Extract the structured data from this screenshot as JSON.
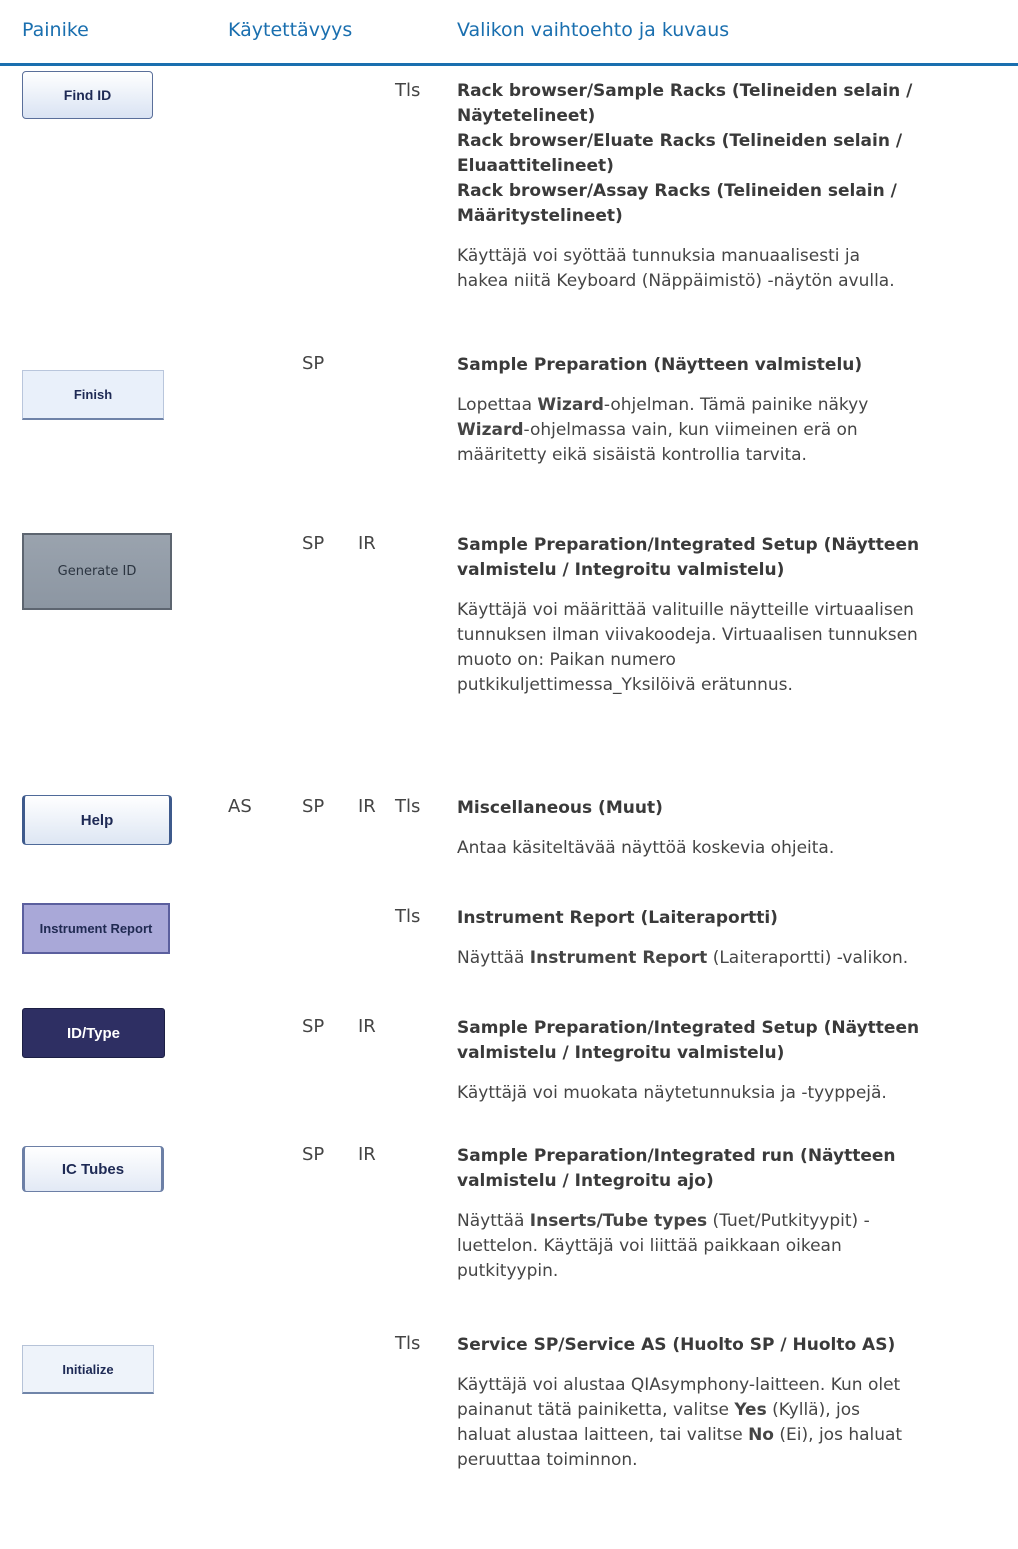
{
  "header": {
    "col_button": "Painike",
    "col_usage": "Käytettävyys",
    "col_menu": "Valikon vaihtoehto ja kuvaus"
  },
  "rows": [
    {
      "button": "Find ID",
      "usage": {
        "as": "",
        "sp": "",
        "ir": "",
        "tls": "Tls"
      },
      "title_lines": [
        "Rack browser/Sample Racks (Telineiden selain /",
        "Näytetelineet)",
        "Rack browser/Eluate Racks (Telineiden selain /",
        "Eluaattitelineet)",
        "Rack browser/Assay Racks (Telineiden selain /",
        "Määritystelineet)"
      ],
      "desc_lines": [
        "Käyttäjä voi syöttää tunnuksia manuaalisesti ja",
        "hakea niitä Keyboard (Näppäimistö) -näytön avulla."
      ]
    },
    {
      "button": "Finish",
      "usage": {
        "as": "",
        "sp": "SP",
        "ir": "",
        "tls": ""
      },
      "title_lines": [
        "Sample Preparation (Näytteen valmistelu)"
      ],
      "desc_lines": [
        "Lopettaa Wizard-ohjelman. Tämä painike näkyy",
        "Wizard-ohjelmassa vain, kun viimeinen erä on",
        "määritetty eikä sisäistä kontrollia tarvita."
      ]
    },
    {
      "button": "Generate ID",
      "usage": {
        "as": "",
        "sp": "SP",
        "ir": "IR",
        "tls": ""
      },
      "title_lines": [
        "Sample Preparation/Integrated Setup (Näytteen",
        "valmistelu / Integroitu valmistelu)"
      ],
      "desc_lines": [
        "Käyttäjä voi määrittää valituille näytteille virtuaalisen",
        "tunnuksen ilman viivakoodeja. Virtuaalisen tunnuksen",
        "muoto on: Paikan numero",
        "putkikuljettimessa_Yksilöivä erätunnus."
      ]
    },
    {
      "button": "Help",
      "usage": {
        "as": "AS",
        "sp": "SP",
        "ir": "IR",
        "tls": "Tls"
      },
      "title_lines": [
        "Miscellaneous (Muut)"
      ],
      "desc_lines": [
        "Antaa käsiteltävää näyttöä koskevia ohjeita."
      ]
    },
    {
      "button": "Instrument Report",
      "usage": {
        "as": "",
        "sp": "",
        "ir": "",
        "tls": "Tls"
      },
      "title_lines": [
        "Instrument Report (Laiteraportti)"
      ],
      "desc_lines": [
        "Näyttää Instrument Report (Laiteraportti) -valikon."
      ]
    },
    {
      "button": "ID/Type",
      "usage": {
        "as": "",
        "sp": "SP",
        "ir": "IR",
        "tls": ""
      },
      "title_lines": [
        "Sample Preparation/Integrated Setup (Näytteen",
        "valmistelu / Integroitu valmistelu)"
      ],
      "desc_lines": [
        "Käyttäjä voi muokata näytetunnuksia ja -tyyppejä."
      ]
    },
    {
      "button": "IC Tubes",
      "usage": {
        "as": "",
        "sp": "SP",
        "ir": "IR",
        "tls": ""
      },
      "title_lines": [
        "Sample Preparation/Integrated run (Näytteen",
        "valmistelu / Integroitu ajo)"
      ],
      "desc_lines": [
        "Näyttää Inserts/Tube types (Tuet/Putkityypit) -",
        "luettelon. Käyttäjä voi liittää paikkaan oikean",
        "putkityypin."
      ]
    },
    {
      "button": "Initialize",
      "usage": {
        "as": "",
        "sp": "",
        "ir": "",
        "tls": "Tls"
      },
      "title_lines": [
        "Service SP/Service AS (Huolto SP / Huolto AS)"
      ],
      "desc_lines": [
        "Käyttäjä voi alustaa QIAsymphony-laitteen. Kun olet",
        "painanut tätä painiketta, valitse Yes (Kyllä), jos",
        "haluat alustaa laitteen, tai valitse No (Ei), jos haluat",
        "peruuttaa toiminnon."
      ]
    }
  ]
}
